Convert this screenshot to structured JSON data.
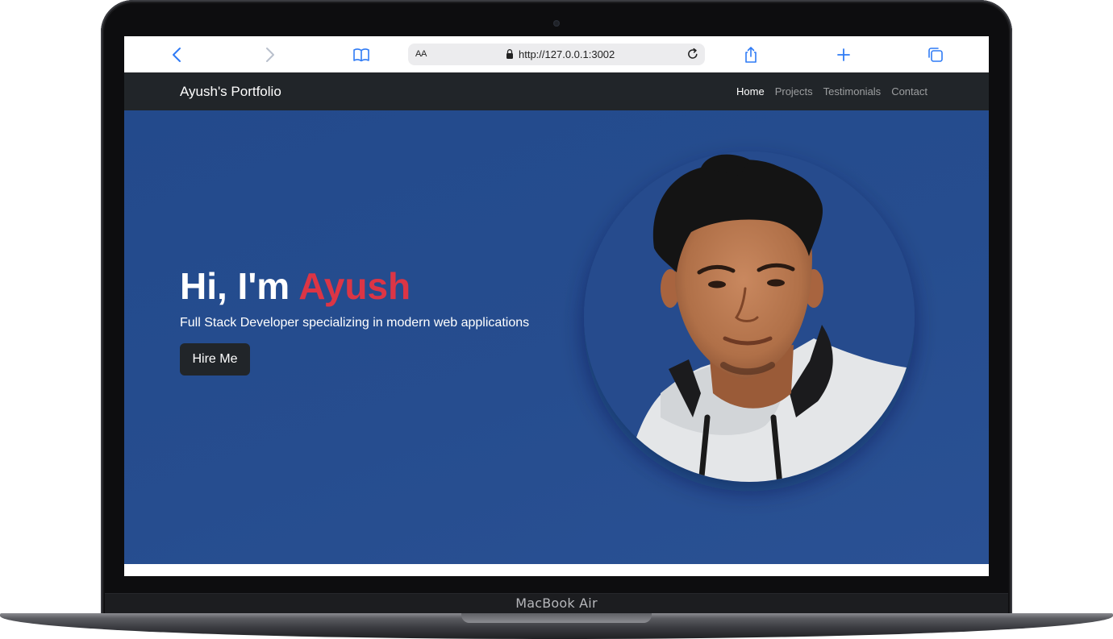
{
  "device": {
    "label": "MacBook Air"
  },
  "browser": {
    "text_size_label": "AA",
    "url": "http://127.0.0.1:3002",
    "icons": {
      "back": "chevron-left-icon",
      "forward": "chevron-right-icon",
      "bookmarks": "book-icon",
      "lock": "lock-icon",
      "reload": "reload-icon",
      "share": "share-icon",
      "new_tab": "plus-icon",
      "tabs": "tabs-icon"
    },
    "accent_color": "#2f7bf5"
  },
  "navbar": {
    "brand": "Ayush's Portfolio",
    "links": [
      {
        "label": "Home",
        "active": true
      },
      {
        "label": "Projects",
        "active": false
      },
      {
        "label": "Testimonials",
        "active": false
      },
      {
        "label": "Contact",
        "active": false
      }
    ],
    "background": "#212529"
  },
  "hero": {
    "greeting": "Hi, I'm",
    "name": "Ayush",
    "subtitle": "Full Stack Developer specializing in modern web applications",
    "cta_label": "Hire Me",
    "background": "#264d8f",
    "name_color": "#dc3545",
    "image": "profile-photo"
  }
}
